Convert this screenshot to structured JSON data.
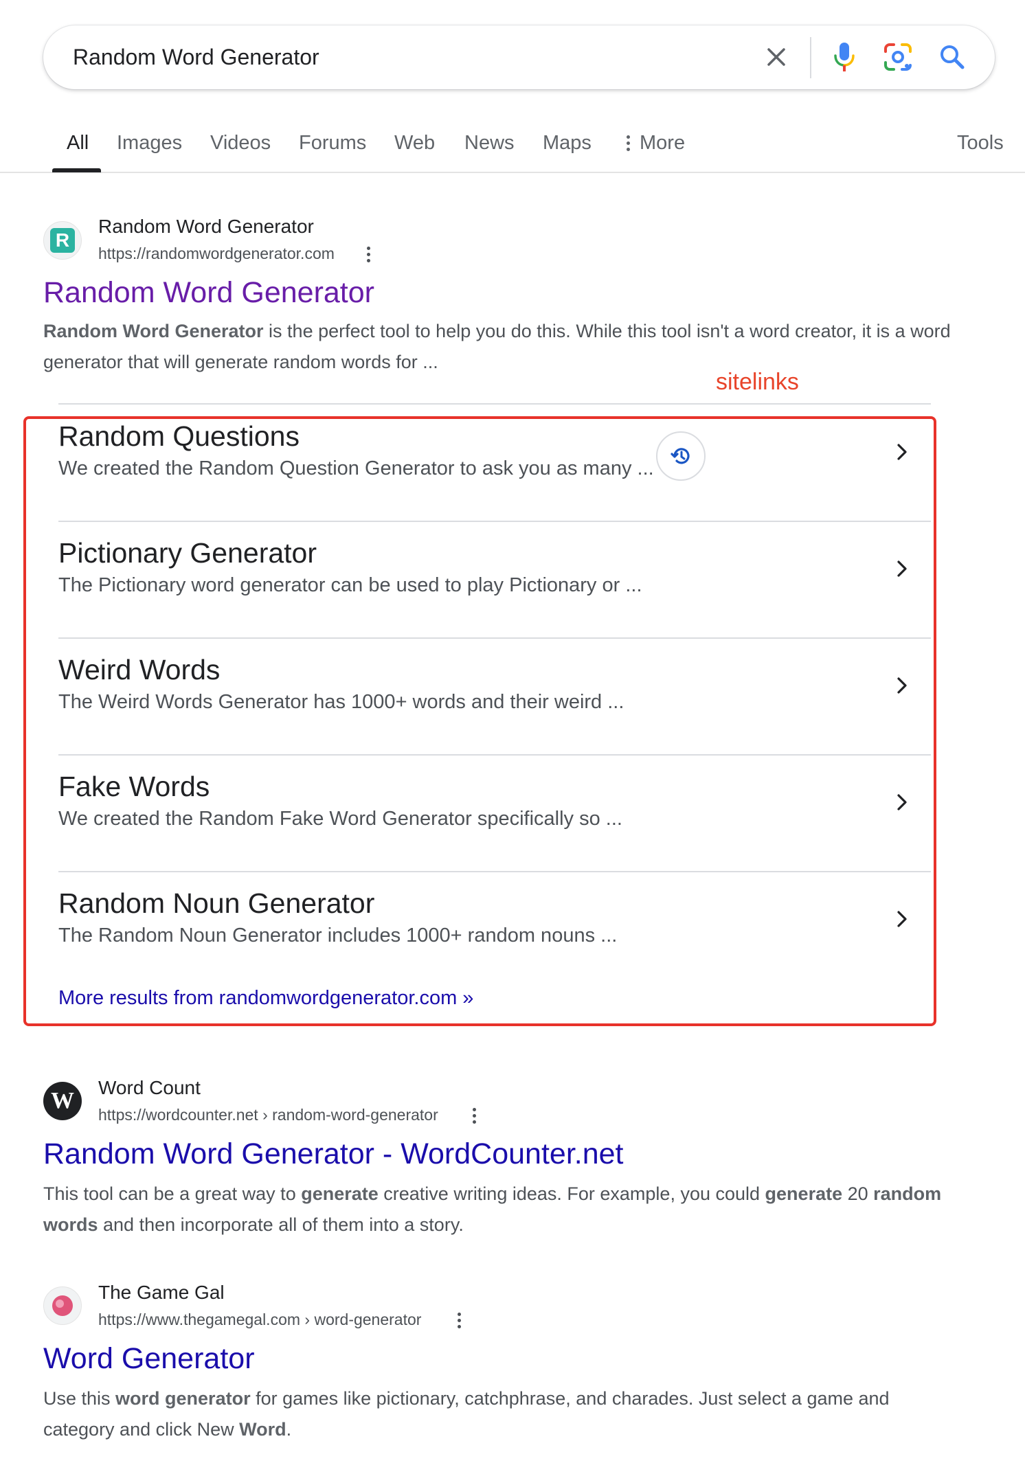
{
  "search": {
    "query": "Random Word Generator",
    "clear_icon": "close-icon",
    "voice_icon": "microphone-icon",
    "lens_icon": "google-lens-icon",
    "search_icon": "search-icon"
  },
  "tabs": {
    "items": [
      "All",
      "Images",
      "Videos",
      "Forums",
      "Web",
      "News",
      "Maps"
    ],
    "more_label": "More",
    "tools_label": "Tools",
    "active": "All"
  },
  "results": [
    {
      "site_name": "Random Word Generator",
      "url": "https://randomwordgenerator.com",
      "favicon_letter": "R",
      "title": "Random Word Generator",
      "snippet_bold": "Random Word Generator",
      "snippet_rest": " is the perfect tool to help you do this. While this tool isn't a word creator, it is a word generator that will generate random words for ..."
    },
    {
      "site_name": "Word Count",
      "url": "https://wordcounter.net › random-word-generator",
      "favicon_letter": "W",
      "title": "Random Word Generator - WordCounter.net",
      "snippet": {
        "a": "This tool can be a great way to ",
        "b1": "generate",
        "c": " creative writing ideas. For example, you could ",
        "b2": "generate",
        "d": " 20 ",
        "b3": "random words",
        "e": " and then incorporate all of them into a story."
      }
    },
    {
      "site_name": "The Game Gal",
      "url": "https://www.thegamegal.com › word-generator",
      "title": "Word Generator",
      "snippet": {
        "a": "Use this ",
        "b1": "word generator",
        "c": " for games like pictionary, catchphrase, and charades. Just select a game and category and click New ",
        "b2": "Word",
        "d": "."
      }
    }
  ],
  "annotation": {
    "label": "sitelinks",
    "color": "#e8322a"
  },
  "sitelinks": [
    {
      "title": "Random Questions",
      "desc": "We created the Random Question Generator to ask you as many ..."
    },
    {
      "title": "Pictionary Generator",
      "desc": "The Pictionary word generator can be used to play Pictionary or ..."
    },
    {
      "title": "Weird Words",
      "desc": "The Weird Words Generator has 1000+ words and their weird ..."
    },
    {
      "title": "Fake Words",
      "desc": "We created the Random Fake Word Generator specifically so ..."
    },
    {
      "title": "Random Noun Generator",
      "desc": "The Random Noun Generator includes 1000+ random nouns ..."
    }
  ],
  "more_results": "More results from randomwordgenerator.com »",
  "colors": {
    "link_visited": "#681da8",
    "link_unvisited": "#1a0dab",
    "accent_blue": "#4285f4"
  }
}
